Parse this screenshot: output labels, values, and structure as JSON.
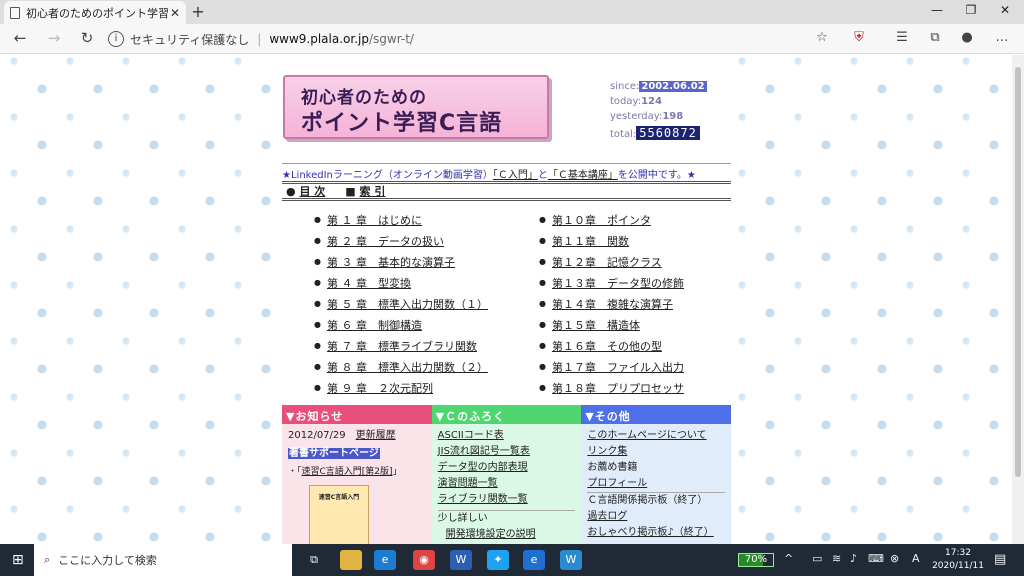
{
  "browser": {
    "tab_title": "初心者のためのポイント学習Ｃ言語",
    "tab_close": "✕",
    "new_tab": "+",
    "url_security": "セキュリティ保護なし",
    "url_host": "www9.plala.or.jp",
    "url_path": "/sgwr-t/"
  },
  "header": {
    "logo_line1": "初心者のための",
    "logo_line2": "ポイント学習C言語",
    "since_label": "since:",
    "since_value": "2002.06.02",
    "today_label": "today:",
    "today_value": "124",
    "yesterday_label": "yesterday:",
    "yesterday_value": "198",
    "total_label": "total:",
    "total_value": "5560872"
  },
  "announcement": {
    "prefix": "★LinkedInラーニング（オンライン動画学習）",
    "link1": "「Ｃ入門」",
    "mid": "と",
    "link2": "「Ｃ基本講座」",
    "suffix": "を公開中です。★"
  },
  "menu": {
    "toc": "目 次",
    "index": "索 引"
  },
  "chapters_left": [
    "第 １ 章　はじめに",
    "第 ２ 章　データの扱い",
    "第 ３ 章　基本的な演算子",
    "第 ４ 章　型変換",
    "第 ５ 章　標準入出力関数（１）",
    "第 ６ 章　制御構造",
    "第 ７ 章　標準ライブラリ関数",
    "第 ８ 章　標準入出力関数（２）",
    "第 ９ 章　２次元配列"
  ],
  "chapters_right": [
    "第１０章　ポインタ",
    "第１１章　関数",
    "第１２章　記憶クラス",
    "第１３章　データ型の修飾",
    "第１４章　複雑な演算子",
    "第１５章　構造体",
    "第１６章　その他の型",
    "第１７章　ファイル入出力",
    "第１８章　プリプロセッサ"
  ],
  "box_news": {
    "heading": "▼お知らせ",
    "date": "2012/07/29",
    "date_link": "更新履歴",
    "highlight": "著書サポートページ",
    "book_prefix": "・「",
    "book_link": "速習C言語入門[第2版]",
    "book_suffix": "」",
    "book_cover": "速習C言語入門"
  },
  "box_extra": {
    "heading": "▼Ｃのふろく",
    "links": [
      "ASCIIコード表",
      "JIS流れ図記号一覧表",
      "データ型の内部表現",
      "演習問題一覧",
      "ライブラリ関数一覧"
    ],
    "more": "少し詳しい",
    "sublink": "開発環境設定の説明"
  },
  "box_other": {
    "heading": "▼その他",
    "items": [
      {
        "text": "このホームページについて",
        "link": true
      },
      {
        "text": "リンク集",
        "link": true
      },
      {
        "text": "お薦め書籍",
        "link": false
      },
      {
        "text": "プロフィール",
        "link": true
      },
      {
        "text": "Ｃ言語関係掲示板（終了）",
        "link": false
      },
      {
        "text": "過去ログ",
        "link": true
      },
      {
        "text": "おしゃべり掲示板♪（終了）",
        "link": true
      }
    ]
  },
  "taskbar": {
    "search_placeholder": "ここに入力して検索",
    "battery": "70%",
    "time": "17:32",
    "date": "2020/11/11"
  }
}
